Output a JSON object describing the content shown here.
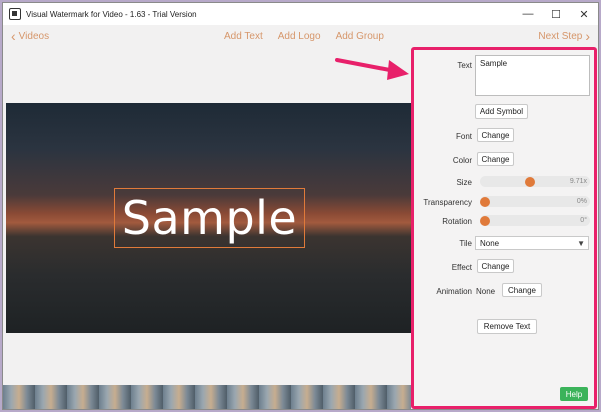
{
  "window": {
    "title": "Visual Watermark for Video - 1.63 - Trial Version",
    "minimize_icon": "minimize-icon",
    "maximize_icon": "maximize-icon",
    "close_icon": "close-icon"
  },
  "nav": {
    "back_label": "Videos",
    "add_text": "Add Text",
    "add_logo": "Add Logo",
    "add_group": "Add Group",
    "next_label": "Next Step"
  },
  "preview": {
    "watermark_text": "Sample"
  },
  "panel": {
    "text_label": "Text",
    "text_value": "Sample",
    "add_symbol": "Add Symbol",
    "font_label": "Font",
    "font_button": "Change",
    "color_label": "Color",
    "color_button": "Change",
    "size_label": "Size",
    "size_value": "9.71x",
    "transparency_label": "Transparency",
    "transparency_value": "0%",
    "rotation_label": "Rotation",
    "rotation_value": "0°",
    "tile_label": "Tile",
    "tile_value": "None",
    "effect_label": "Effect",
    "effect_button": "Change",
    "animation_label": "Animation",
    "animation_value": "None",
    "animation_button": "Change",
    "remove_text": "Remove Text",
    "help": "Help"
  },
  "colors": {
    "accent": "#e07a3a",
    "nav_text": "#d6966a",
    "highlight": "#e8206a",
    "help_green": "#3bb35a"
  },
  "sliders": {
    "size_level": 0.45,
    "transparency_level": 0.0,
    "rotation_level": 0.0
  }
}
